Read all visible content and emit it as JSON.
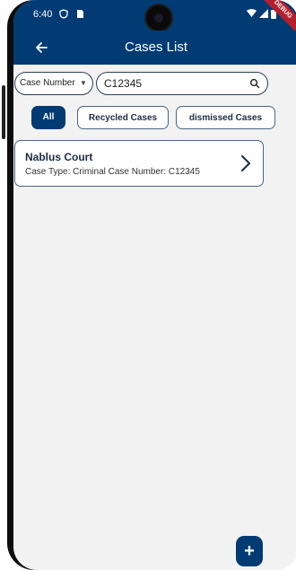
{
  "status_bar": {
    "time": "6:40",
    "icons_left": [
      "shield-status-icon",
      "sim-card-icon"
    ],
    "icons_right": [
      "wifi-icon",
      "signal-icon",
      "battery-icon"
    ],
    "debug_label": "DEBUG"
  },
  "app_bar": {
    "back_icon": "arrow-left-icon",
    "title": "Cases List"
  },
  "filter": {
    "selected_field": "Case Number",
    "search_value": "C12345"
  },
  "tabs": [
    {
      "label": "All",
      "active": true
    },
    {
      "label": "Recycled Cases",
      "active": false
    },
    {
      "label": "dismissed Cases",
      "active": false
    }
  ],
  "cases": [
    {
      "court": "Nablus Court",
      "meta": "Case Type: Criminal  Case Number: C12345"
    }
  ],
  "fab": {
    "label": "+"
  },
  "colors": {
    "primary": "#003b73",
    "background": "#f2f2f2",
    "card_border": "#4a6587",
    "debug_ribbon": "#b21f2d"
  }
}
